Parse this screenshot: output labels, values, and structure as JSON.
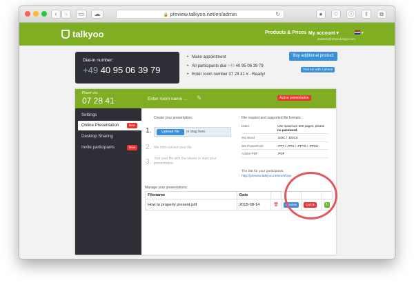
{
  "browser": {
    "url": "preview.talkyoo.net/en/admin",
    "lock_icon": "lock-icon",
    "reload_icon": "reload-icon"
  },
  "header": {
    "logo_text": "talkyoo",
    "nav": {
      "products": "Products & Prices",
      "account": "My account ▾"
    },
    "email": "andreas@shea.design.com"
  },
  "dialin": {
    "label": "Dial-in number:",
    "prefix": "+49",
    "number": "40 95 06 39 79"
  },
  "steps": {
    "s1": "Make appointment",
    "s2_pre": "All participants dial",
    "s2_prefix": "+49",
    "s2_num": "40 95 06 39 79",
    "s3": "Enter room number 07 28 41 # - Ready!"
  },
  "buttons": {
    "buy": "Buy additional product",
    "trial": "Trial run with 1 phone"
  },
  "room": {
    "label": "Room no.",
    "number": "07 28 41",
    "name_placeholder": "Enter room name ...",
    "status": "Active presentation"
  },
  "sidebar": {
    "items": [
      {
        "label": "Settings"
      },
      {
        "label": "Online Presentation",
        "badge": "New"
      },
      {
        "label": "Desktop Sharing"
      },
      {
        "label": "Invite participants",
        "badge": "New"
      }
    ]
  },
  "create": {
    "title": "Create your presentation:",
    "steps": [
      {
        "num": "1.",
        "upload": "Upload file",
        "drag": "or drag here."
      },
      {
        "num": "2.",
        "text": "We now convert your file."
      },
      {
        "num": "3.",
        "text": "Test your file with the viewer or start your presentation."
      }
    ]
  },
  "formats": {
    "title": "File request and supported file formats:",
    "rows": [
      {
        "k": "Datei",
        "v": "Use maximum 200 pages, please",
        "vb": "no password."
      },
      {
        "k": "MS Word",
        "v": ".DOC / .DOCX"
      },
      {
        "k": "MS PowerPoint",
        "v": ".PPT / .PPS / .PPTX / .PPSX"
      },
      {
        "k": "Adobe PDF",
        "v": ".PDF"
      }
    ],
    "link_title": "The link for your participants:",
    "link_url": "http://preview.talkyoo.net/en/show"
  },
  "manage": {
    "title": "Manage your presentations:",
    "headers": {
      "filename": "Filename",
      "date": "Date"
    },
    "rows": [
      {
        "filename": "How to properly present.pdf",
        "date": "2015-08-14",
        "preview": "Preview",
        "quit": "Quit"
      }
    ]
  },
  "colors": {
    "brand_green": "#7fae22",
    "dark_panel": "#2e2f36",
    "action_blue": "#3b8fd9",
    "alert_red": "#e33",
    "annotation_circle": "#e2555e"
  }
}
